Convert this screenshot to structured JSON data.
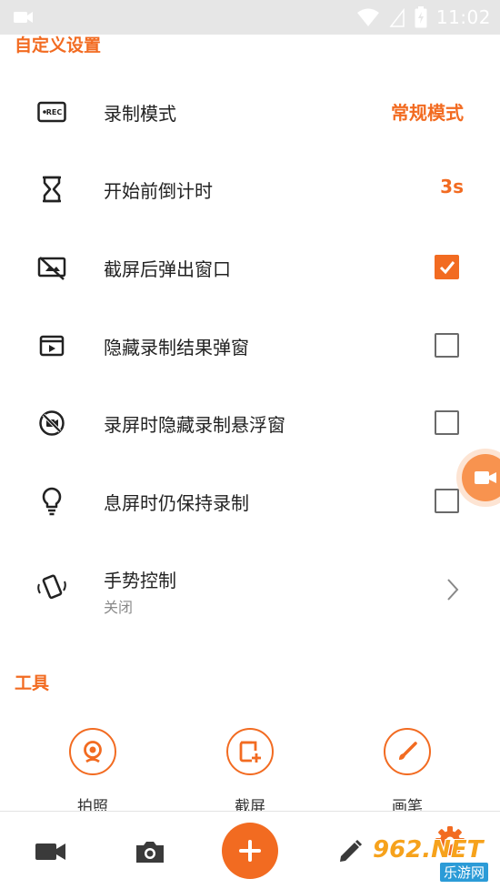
{
  "status_bar": {
    "time": "11:02"
  },
  "sections": {
    "custom_title": "自定义设置",
    "tools_title": "工具"
  },
  "settings": [
    {
      "icon": "rec-icon",
      "label": "录制模式",
      "value": "常规模式",
      "control": "value"
    },
    {
      "icon": "hourglass-icon",
      "label": "开始前倒计时",
      "value": "3s",
      "control": "value"
    },
    {
      "icon": "screenshot-off-icon",
      "label": "截屏后弹出窗口",
      "checked": true,
      "control": "checkbox"
    },
    {
      "icon": "media-window-icon",
      "label": "隐藏录制结果弹窗",
      "checked": false,
      "control": "checkbox"
    },
    {
      "icon": "hide-float-icon",
      "label": "录屏时隐藏录制悬浮窗",
      "checked": false,
      "control": "checkbox"
    },
    {
      "icon": "lightbulb-icon",
      "label": "息屏时仍保持录制",
      "checked": false,
      "control": "checkbox"
    }
  ],
  "gesture": {
    "icon": "shake-phone-icon",
    "label": "手势控制",
    "sublabel": "关闭"
  },
  "tools": [
    {
      "icon": "webcam-icon",
      "label": "拍照"
    },
    {
      "icon": "screenshot-add-icon",
      "label": "截屏"
    },
    {
      "icon": "brush-icon",
      "label": "画笔"
    }
  ],
  "bottom_nav": [
    "video-camera-icon",
    "camera-icon",
    "plus-icon",
    "pencil-icon",
    "gear-icon"
  ],
  "watermark": {
    "main": "962.NET",
    "sub": "乐游网"
  },
  "colors": {
    "accent": "#f26b21",
    "text": "#222222",
    "subtext": "#8a8a8a",
    "checkbox_border": "#6a6a6a"
  }
}
